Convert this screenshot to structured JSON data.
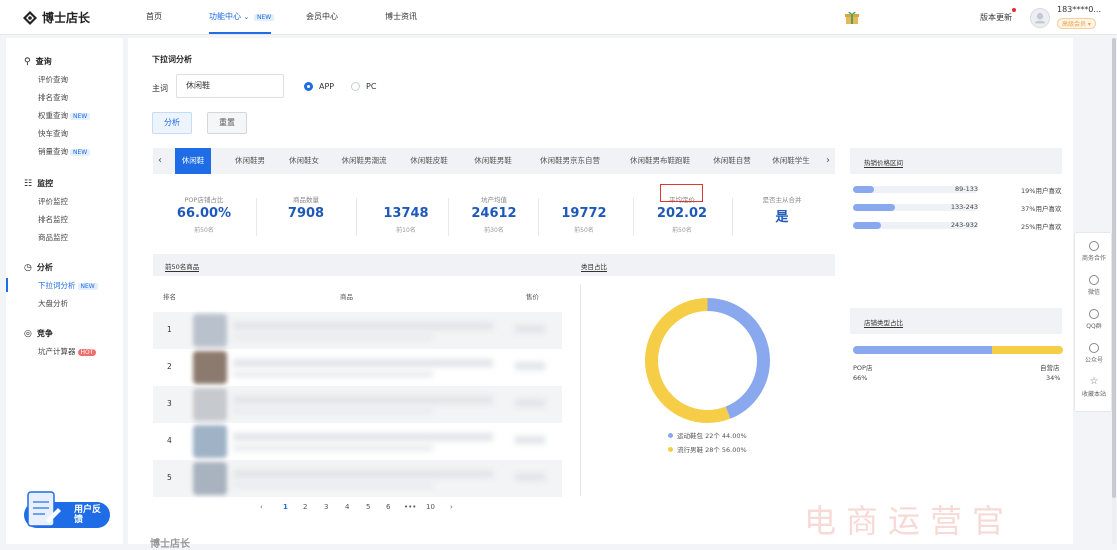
{
  "header": {
    "logo_text": "博士店长",
    "nav": [
      {
        "label": "首页"
      },
      {
        "label": "功能中心",
        "badge": "NEW"
      },
      {
        "label": "会员中心"
      },
      {
        "label": "博士资讯"
      }
    ],
    "update_label": "版本更新",
    "user_phone": "183****0...",
    "user_level": "高级会员 ▾"
  },
  "sidebar": {
    "sections": [
      {
        "title": "查询",
        "items": [
          "评价查询",
          "排名查询",
          "权重查询",
          "快车查询",
          "销量查询"
        ],
        "badges": {
          "2": "NEW",
          "4": "NEW"
        }
      },
      {
        "title": "监控",
        "items": [
          "评价监控",
          "排名监控",
          "商品监控"
        ]
      },
      {
        "title": "分析",
        "items": [
          "下拉词分析",
          "大盘分析"
        ],
        "badges": {
          "0": "NEW"
        }
      },
      {
        "title": "竞争",
        "items": [
          "坑产计算器"
        ],
        "badges": {
          "0": "HOT"
        }
      }
    ],
    "feedback": "用户反馈"
  },
  "main": {
    "page_title": "下拉词分析",
    "keyword_label": "主词",
    "keyword_value": "休闲鞋",
    "platforms": [
      "APP",
      "PC"
    ],
    "platform_selected": "APP",
    "analyze_label": "分析",
    "reset_label": "重置",
    "tabs": [
      "休闲鞋",
      "休闲鞋男",
      "休闲鞋女",
      "休闲鞋男潮流",
      "休闲鞋皮鞋",
      "休闲鞋男鞋",
      "休闲鞋男京东自营",
      "休闲鞋男布鞋跑鞋",
      "休闲鞋自营",
      "休闲鞋学生"
    ],
    "metrics": [
      {
        "label": "POP店铺占比",
        "value": "66.00%",
        "rank": "前50名"
      },
      {
        "label": "商品数量",
        "value": "7908",
        "rank": ""
      },
      {
        "label": "",
        "value": "13748",
        "rank": "前10名"
      },
      {
        "label": "坑产均值",
        "value": "24612",
        "rank": "前30名"
      },
      {
        "label": "",
        "value": "19772",
        "rank": "前50名"
      },
      {
        "label": "平均定价",
        "value": "202.02",
        "rank": "前50名"
      },
      {
        "label": "是否主从合并",
        "value": "是",
        "rank": ""
      }
    ],
    "price_range": {
      "title": "热销价格区间",
      "rows": [
        {
          "range": "89-133",
          "pct": 19,
          "text": "19%用户喜欢"
        },
        {
          "range": "133-243",
          "pct": 37,
          "text": "37%用户喜欢"
        },
        {
          "range": "243-932",
          "pct": 25,
          "text": "25%用户喜欢"
        }
      ]
    },
    "store_type": {
      "title": "店铺类型占比",
      "left_label": "POP店",
      "left_pct": "66%",
      "right_label": "自营店",
      "right_pct": "34%",
      "left_value": 66
    },
    "table": {
      "title": "前50名商品",
      "columns": [
        "排名",
        "商品",
        "售价"
      ],
      "rows": [
        "1",
        "2",
        "3",
        "4",
        "5"
      ]
    },
    "category_chart_title": "类目占比",
    "pagination": [
      "‹",
      "1",
      "2",
      "3",
      "4",
      "5",
      "6",
      "•••",
      "10",
      "›"
    ],
    "footer_logo": "博士店长"
  },
  "chart_data": {
    "type": "pie",
    "title": "类目占比",
    "categories": [
      "运动鞋包",
      "流行男鞋"
    ],
    "values": [
      22,
      28
    ],
    "percent": [
      44.0,
      56.0
    ],
    "legend": [
      "运动鞋包 22个 44.00%",
      "流行男鞋 28个 56.00%"
    ],
    "colors": [
      "#8aa8ee",
      "#f6cd47"
    ],
    "legend_position": "bottom"
  },
  "tools": [
    "商务合作",
    "微信",
    "QQ群",
    "公众号",
    "收藏本站"
  ],
  "watermark": "电商运营官"
}
